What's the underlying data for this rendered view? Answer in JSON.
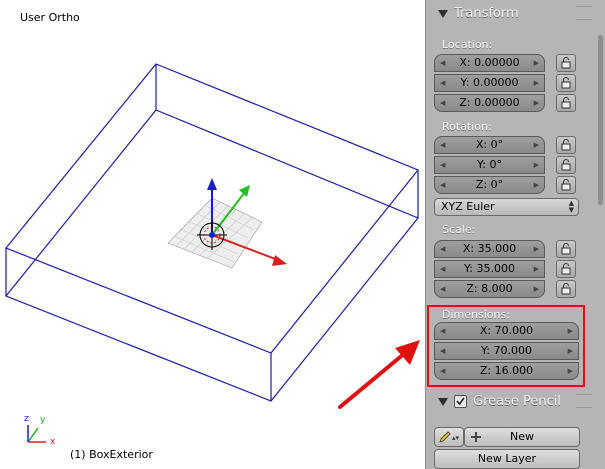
{
  "viewport": {
    "view_name": "User Ortho",
    "object_label": "(1) BoxExterior",
    "axes": {
      "x": "x",
      "y": "y",
      "z": "z"
    }
  },
  "transform": {
    "title": "Transform",
    "location": {
      "label": "Location:",
      "x": "X: 0.00000",
      "y": "Y: 0.00000",
      "z": "Z: 0.00000"
    },
    "rotation": {
      "label": "Rotation:",
      "x": "X: 0°",
      "y": "Y: 0°",
      "z": "Z: 0°",
      "mode": "XYZ Euler"
    },
    "scale": {
      "label": "Scale:",
      "x": "X: 35.000",
      "y": "Y: 35.000",
      "z": "Z: 8.000"
    },
    "dimensions": {
      "label": "Dimensions:",
      "x": "X: 70.000",
      "y": "Y: 70.000",
      "z": "Z: 16.000"
    }
  },
  "grease_pencil": {
    "title": "Grease Pencil",
    "new_label": "New",
    "new_layer_label": "New Layer"
  },
  "colors": {
    "panel_bg": "#b5b5b5",
    "wire": "#1a1ab0",
    "highlight": "#e01010",
    "arrow": "#e01010"
  }
}
